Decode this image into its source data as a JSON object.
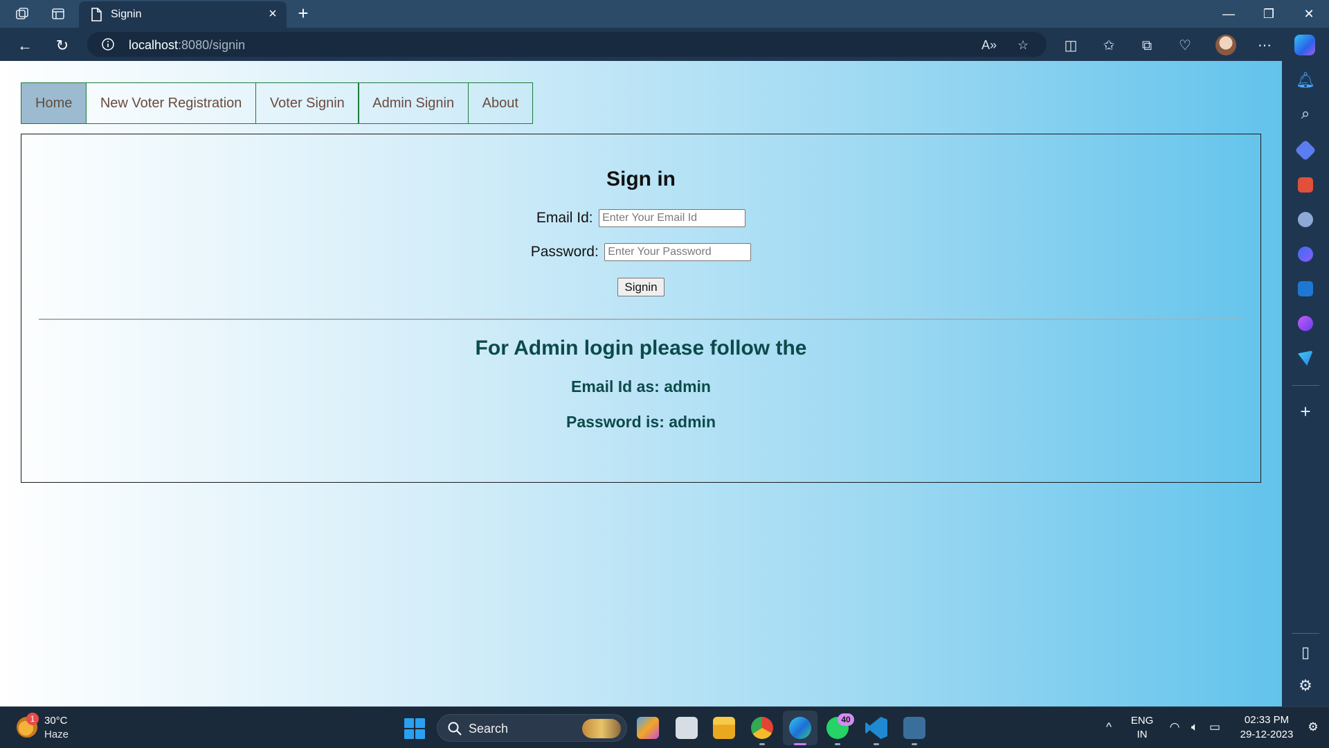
{
  "browser": {
    "tab_title": "Signin",
    "url_host": "localhost",
    "url_rest": ":8080/signin"
  },
  "page": {
    "nav_items": [
      "Home",
      "New Voter Registration",
      "Voter Signin",
      "Admin Signin",
      "About"
    ],
    "active_nav": "Home",
    "form": {
      "title": "Sign in",
      "email_label": "Email Id:",
      "email_placeholder": "Enter Your Email Id",
      "email_value": "",
      "password_label": "Password:",
      "password_placeholder": "Enter Your Password",
      "password_value": "",
      "submit_label": "Signin"
    },
    "admin_info": {
      "heading": "For Admin login please follow the",
      "email_line": "Email Id as: admin",
      "password_line": "Password is: admin"
    }
  },
  "taskbar": {
    "weather": {
      "temp": "30°C",
      "desc": "Haze",
      "badge": "1"
    },
    "search_label": "Search",
    "whatsapp_badge": "40",
    "lang_1": "ENG",
    "lang_2": "IN",
    "time": "02:33 PM",
    "date": "29-12-2023"
  },
  "colors": {
    "navbar_border": "#1e7a3a",
    "nav_active_bg": "#9cbad0",
    "admin_text": "#0c4a4a",
    "browser_frame": "#1f3651"
  },
  "icons": {
    "tab_bar": [
      "workspaces-icon",
      "tab-actions-icon",
      "page-icon",
      "close-tab-icon",
      "new-tab-icon"
    ],
    "toolbar": [
      "back-icon",
      "refresh-icon",
      "info-icon",
      "read-aloud-icon",
      "favorite-star-icon",
      "split-screen-icon",
      "favorites-icon",
      "collections-icon",
      "performance-icon",
      "profile-avatar",
      "more-menu-icon",
      "copilot-icon"
    ],
    "sidebar": [
      "notification-bell-icon",
      "search-icon",
      "shopping-tag-icon",
      "tools-icon",
      "games-icon",
      "microsoft365-icon",
      "outlook-icon",
      "designer-icon",
      "drop-icon",
      "add-icon",
      "sidebar-layout-icon",
      "settings-gear-icon"
    ]
  }
}
